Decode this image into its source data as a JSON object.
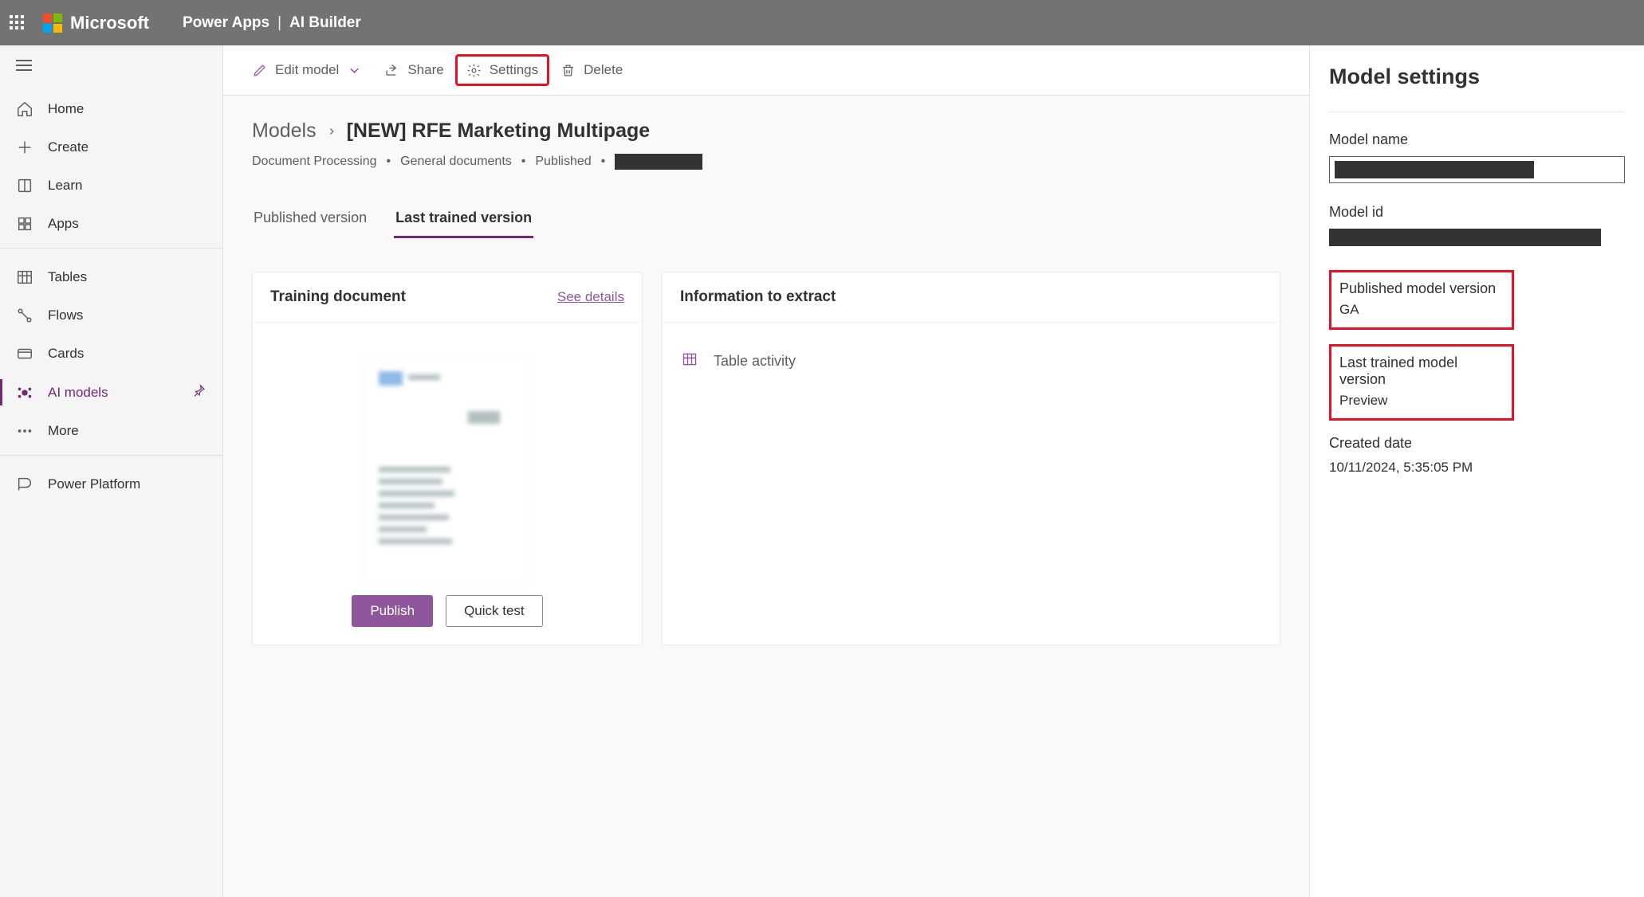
{
  "topbar": {
    "brand": "Microsoft",
    "app": "Power Apps",
    "section": "AI Builder"
  },
  "leftnav": {
    "items_a": [
      {
        "key": "home",
        "label": "Home"
      },
      {
        "key": "create",
        "label": "Create"
      },
      {
        "key": "learn",
        "label": "Learn"
      },
      {
        "key": "apps",
        "label": "Apps"
      }
    ],
    "items_b": [
      {
        "key": "tables",
        "label": "Tables"
      },
      {
        "key": "flows",
        "label": "Flows"
      },
      {
        "key": "cards",
        "label": "Cards"
      },
      {
        "key": "ai-models",
        "label": "AI models"
      },
      {
        "key": "more",
        "label": "More"
      }
    ],
    "items_c": [
      {
        "key": "power-platform",
        "label": "Power Platform"
      }
    ]
  },
  "cmdbar": {
    "edit": "Edit model",
    "share": "Share",
    "settings": "Settings",
    "delete": "Delete"
  },
  "breadcrumb": {
    "root": "Models",
    "current": "[NEW] RFE Marketing Multipage"
  },
  "meta": {
    "type": "Document Processing",
    "subtype": "General documents",
    "status": "Published"
  },
  "tabs": {
    "published": "Published version",
    "trained": "Last trained version"
  },
  "cards": {
    "training_title": "Training document",
    "training_link": "See details",
    "extract_title": "Information to extract",
    "extract_item": "Table activity",
    "publish_btn": "Publish",
    "quicktest_btn": "Quick test"
  },
  "rpanel": {
    "title": "Model settings",
    "model_name_label": "Model name",
    "model_id_label": "Model id",
    "published_ver_label": "Published model version",
    "published_ver_value": "GA",
    "trained_ver_label": "Last trained model version",
    "trained_ver_value": "Preview",
    "created_label": "Created date",
    "created_value": "10/11/2024, 5:35:05 PM"
  }
}
